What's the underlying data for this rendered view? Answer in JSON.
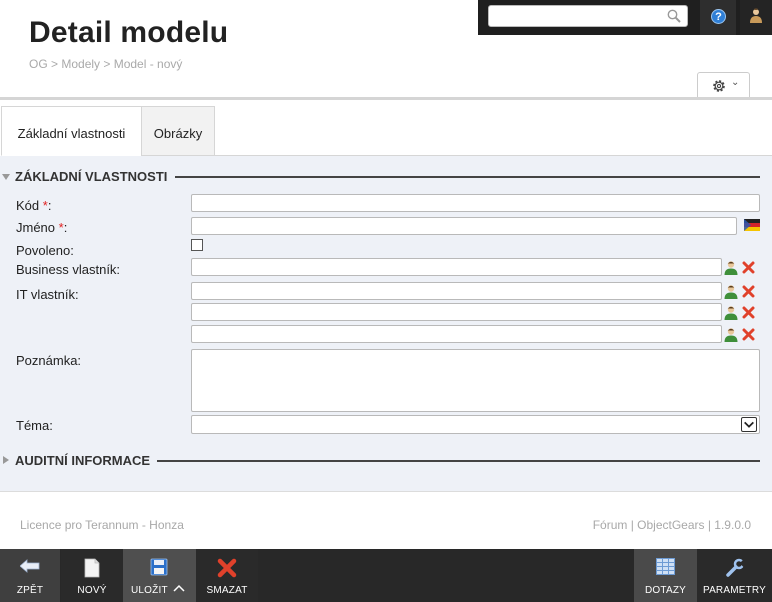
{
  "topbar": {
    "search_value": "",
    "help_glyph": "?"
  },
  "header": {
    "title": "Detail modelu",
    "breadcrumb": "OG > Modely > Model - nový",
    "settings_caret": "⌄"
  },
  "tabs": [
    {
      "label": "Základní vlastnosti",
      "active": true
    },
    {
      "label": "Obrázky",
      "active": false
    }
  ],
  "form": {
    "section_basic": "ZÁKLADNÍ VLASTNOSTI",
    "section_audit": "AUDITNÍ INFORMACE",
    "required_mark": "*",
    "fields": {
      "code_label": "Kód",
      "name_label": "Jméno",
      "enabled_label": "Povoleno:",
      "business_owner_label": "Business vlastník:",
      "it_owner_label": "IT vlastník:",
      "note_label": "Poznámka:",
      "theme_label": "Téma:",
      "colon": ":"
    },
    "values": {
      "code": "",
      "name": "",
      "business_owner": "",
      "it_owner_1": "",
      "it_owner_2": "",
      "it_owner_3": "",
      "note": "",
      "theme": ""
    }
  },
  "footer": {
    "license": "Licence pro Terannum - Honza",
    "links": "Fórum | ObjectGears | 1.9.0.0"
  },
  "toolbar": {
    "back": "ZPĚT",
    "new": "NOVÝ",
    "save": "ULOŽIT",
    "delete": "SMAZAT",
    "queries": "DOTAZY",
    "params": "PARAMETRY"
  },
  "colors": {
    "toolbar_bg": "#282828",
    "content_bg": "#eef1f7",
    "required": "#e02020",
    "delete_red": "#e0412b"
  }
}
